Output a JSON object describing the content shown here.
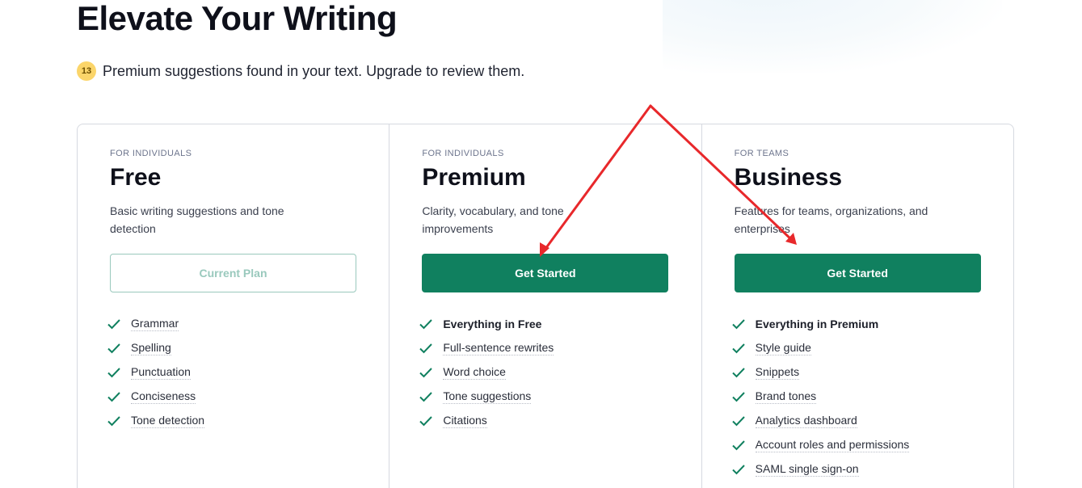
{
  "header": {
    "title": "Elevate Your Writing"
  },
  "notice": {
    "badge_count": "13",
    "text": "Premium suggestions found in your text. Upgrade to review them."
  },
  "plans": [
    {
      "audience": "FOR INDIVIDUALS",
      "name": "Free",
      "description": "Basic writing suggestions and tone detection",
      "button_label": "Current Plan",
      "features": [
        {
          "label": "Grammar",
          "bold": false
        },
        {
          "label": "Spelling",
          "bold": false
        },
        {
          "label": "Punctuation",
          "bold": false
        },
        {
          "label": "Conciseness",
          "bold": false
        },
        {
          "label": "Tone detection",
          "bold": false
        }
      ]
    },
    {
      "audience": "FOR INDIVIDUALS",
      "name": "Premium",
      "description": "Clarity, vocabulary, and tone improvements",
      "button_label": "Get Started",
      "features": [
        {
          "label": "Everything in Free",
          "bold": true
        },
        {
          "label": "Full-sentence rewrites",
          "bold": false
        },
        {
          "label": "Word choice",
          "bold": false
        },
        {
          "label": "Tone suggestions",
          "bold": false
        },
        {
          "label": "Citations",
          "bold": false
        }
      ]
    },
    {
      "audience": "FOR TEAMS",
      "name": "Business",
      "description": "Features for teams, organizations, and enterprises",
      "button_label": "Get Started",
      "features": [
        {
          "label": "Everything in Premium",
          "bold": true
        },
        {
          "label": "Style guide",
          "bold": false
        },
        {
          "label": "Snippets",
          "bold": false
        },
        {
          "label": "Brand tones",
          "bold": false
        },
        {
          "label": "Analytics dashboard",
          "bold": false
        },
        {
          "label": "Account roles and permissions",
          "bold": false
        },
        {
          "label": "SAML single sign-on",
          "bold": false
        }
      ]
    }
  ],
  "colors": {
    "brand_green": "#10805f",
    "check_green": "#10805f",
    "badge_yellow": "#fbd56a",
    "annotation_red": "#e8282b"
  },
  "icons": {
    "feature_check": "check-icon",
    "annotation": "red-arrow-annotation"
  }
}
